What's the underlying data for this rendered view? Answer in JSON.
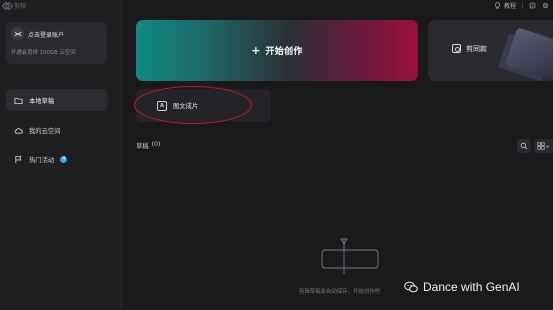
{
  "app": {
    "title": "剪映"
  },
  "topbar": {
    "tutorial_label": "教程"
  },
  "sidebar": {
    "account": {
      "login_label": "点击登录账户",
      "promo": "开通会员得 100GB 云空间"
    },
    "nav": [
      {
        "label": "本地草稿",
        "active": true
      },
      {
        "label": "我的云空间",
        "active": false
      },
      {
        "label": "热门活动",
        "active": false,
        "badge": "4"
      }
    ]
  },
  "main": {
    "create_label": "开始创作",
    "edit_same_label": "剪同款",
    "pic_to_video_label": "图文成片",
    "drafts": {
      "title": "草稿",
      "count": "(0)"
    },
    "empty_text": "剪辑草稿会自动保存，开始创作吧"
  },
  "watermark": {
    "text": "Dance with GenAI"
  },
  "colors": {
    "accent_badge": "#2aa8e0",
    "highlight": "#c51b2a",
    "create_gradient_start": "#0e8a86",
    "create_gradient_end": "#99103c"
  }
}
